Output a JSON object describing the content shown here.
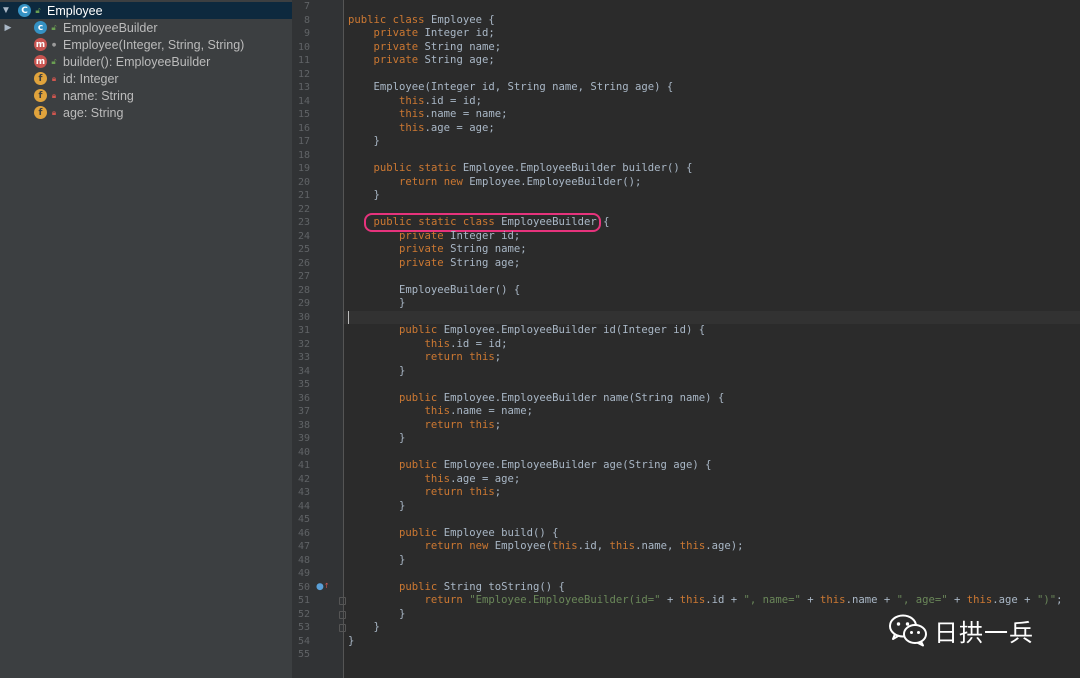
{
  "structure": {
    "root": {
      "label": "Employee",
      "icon": "class-icon"
    },
    "items": [
      {
        "label": "EmployeeBuilder",
        "badge": "c",
        "modifier": "unlock"
      },
      {
        "label": "Employee(Integer, String, String)",
        "badge": "m",
        "modifier": "dot"
      },
      {
        "label": "builder(): EmployeeBuilder",
        "badge": "m",
        "modifier": "unlock"
      },
      {
        "label": "id: Integer",
        "badge": "f",
        "modifier": "lock"
      },
      {
        "label": "name: String",
        "badge": "f",
        "modifier": "lock"
      },
      {
        "label": "age: String",
        "badge": "f",
        "modifier": "lock"
      }
    ]
  },
  "editor": {
    "first_line_number": 7,
    "caret_line": 30,
    "highlighted_line": 23,
    "lines": [
      "",
      "public class Employee {",
      "    private Integer id;",
      "    private String name;",
      "    private String age;",
      "",
      "    Employee(Integer id, String name, String age) {",
      "        this.id = id;",
      "        this.name = name;",
      "        this.age = age;",
      "    }",
      "",
      "    public static Employee.EmployeeBuilder builder() {",
      "        return new Employee.EmployeeBuilder();",
      "    }",
      "",
      "    public static class EmployeeBuilder {",
      "        private Integer id;",
      "        private String name;",
      "        private String age;",
      "",
      "        EmployeeBuilder() {",
      "        }",
      "",
      "        public Employee.EmployeeBuilder id(Integer id) {",
      "            this.id = id;",
      "            return this;",
      "        }",
      "",
      "        public Employee.EmployeeBuilder name(String name) {",
      "            this.name = name;",
      "            return this;",
      "        }",
      "",
      "        public Employee.EmployeeBuilder age(String age) {",
      "            this.age = age;",
      "            return this;",
      "        }",
      "",
      "        public Employee build() {",
      "            return new Employee(this.id, this.name, this.age);",
      "        }",
      "",
      "        public String toString() {",
      "            return \"Employee.EmployeeBuilder(id=\" + this.id + \", name=\" + this.name + \", age=\" + this.age + \")\";",
      "        }",
      "    }",
      "}",
      ""
    ]
  },
  "watermark": {
    "text": "日拱一兵",
    "icon": "wechat-icon"
  },
  "colors": {
    "keyword": "#cc7832",
    "string": "#6a8759",
    "text": "#a9b7c6",
    "highlight": "#e6337c",
    "selection": "#0d293e"
  }
}
